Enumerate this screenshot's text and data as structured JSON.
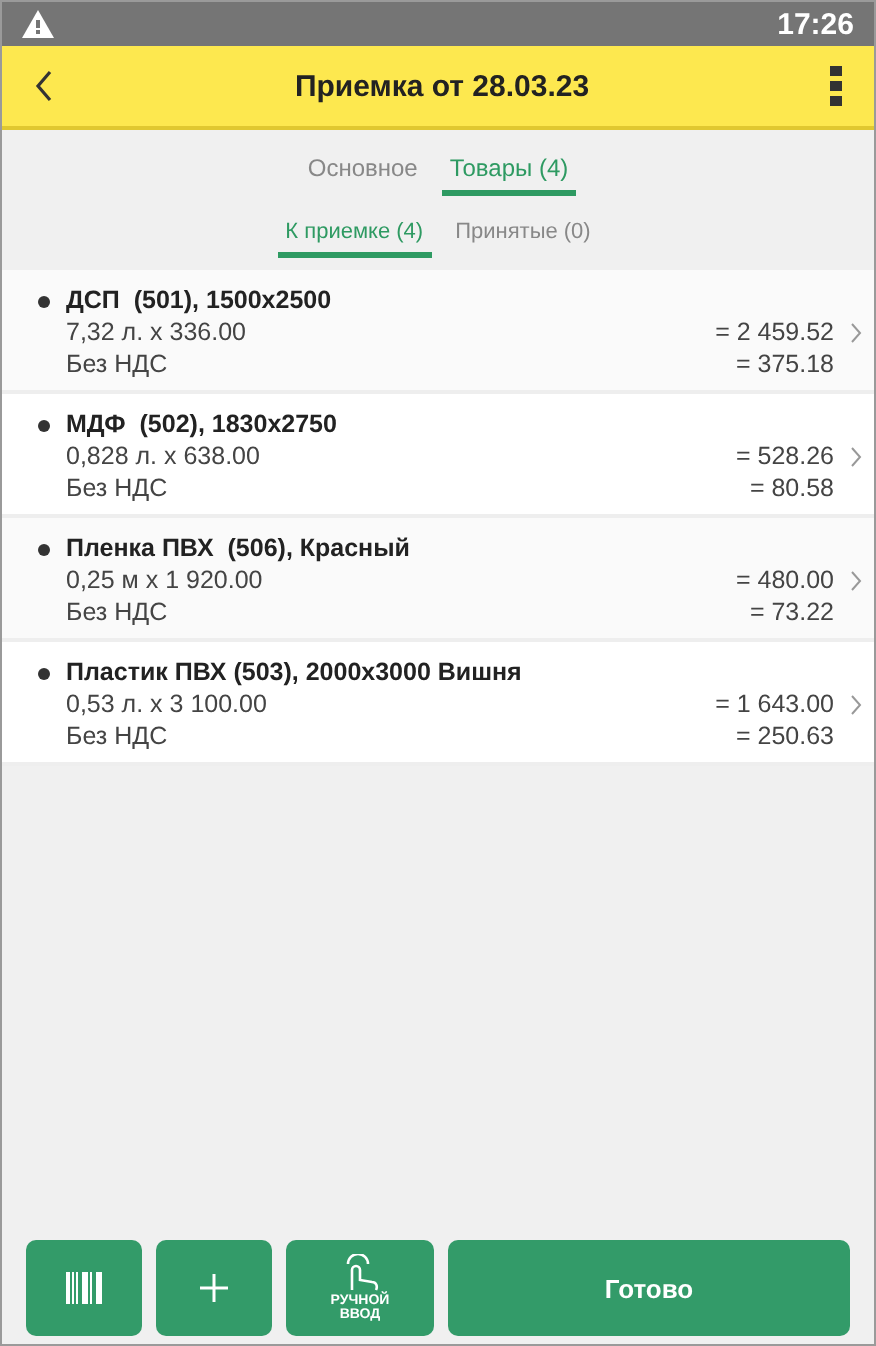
{
  "status_bar": {
    "time": "17:26"
  },
  "header": {
    "title": "Приемка от 28.03.23"
  },
  "tabs": [
    {
      "label": "Основное",
      "selected": false
    },
    {
      "label": "Товары (4)",
      "selected": true
    }
  ],
  "subtabs": [
    {
      "label": "К приемке (4)",
      "selected": true
    },
    {
      "label": "Принятые (0)",
      "selected": false
    }
  ],
  "items": [
    {
      "name": "ДСП  (501), 1500x2500",
      "qty": "7,32 л. х 336.00",
      "sum": "= 2 459.52",
      "vat_label": "Без НДС",
      "vat": "= 375.18"
    },
    {
      "name": "МДФ  (502), 1830x2750",
      "qty": "0,828 л. х 638.00",
      "sum": "= 528.26",
      "vat_label": "Без НДС",
      "vat": "= 80.58"
    },
    {
      "name": "Пленка ПВХ  (506), Красный",
      "qty": "0,25 м х 1 920.00",
      "sum": "= 480.00",
      "vat_label": "Без НДС",
      "vat": "= 73.22"
    },
    {
      "name": "Пластик ПВХ (503), 2000x3000 Вишня",
      "qty": "0,53 л. х 3 100.00",
      "sum": "= 1 643.00",
      "vat_label": "Без НДС",
      "vat": "= 250.63"
    }
  ],
  "toolbar": {
    "manual_label": [
      "РУЧНОЙ",
      "ВВОД"
    ],
    "done": "Готово"
  }
}
